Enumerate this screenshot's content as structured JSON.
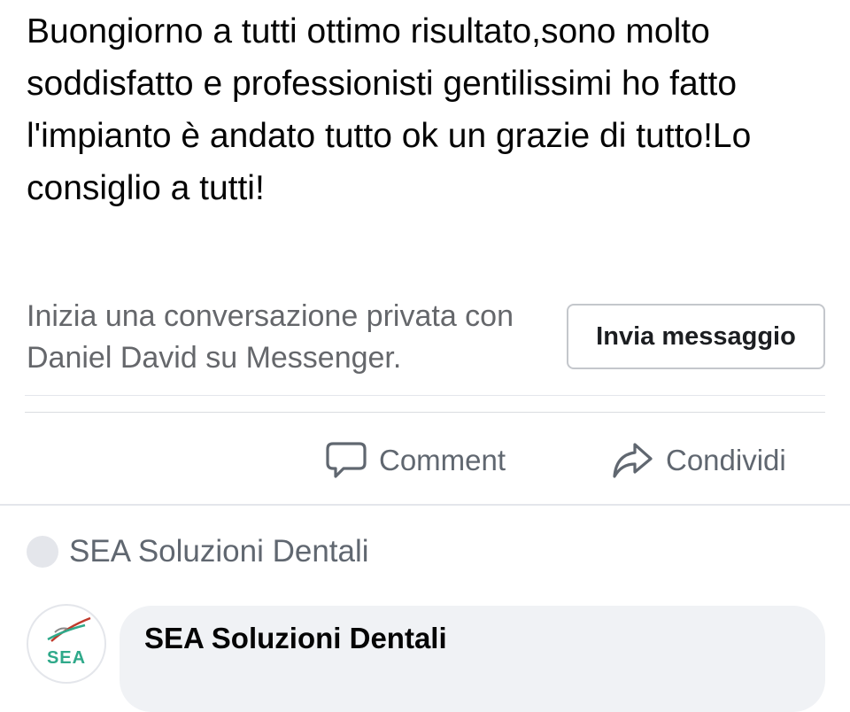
{
  "post": {
    "text": "Buongiorno a tutti ottimo risultato,sono molto soddisfatto e professionisti gentilissimi ho fatto l'impianto è andato tutto ok un grazie di tutto!Lo consiglio a tutti!"
  },
  "messenger_prompt": {
    "text": "Inizia una conversazione privata con Daniel David su Messenger.",
    "button_label": "Invia messaggio"
  },
  "actions": {
    "comment_label": "Comment",
    "comment_icon": "comment-bubble-icon",
    "share_label": "Condividi",
    "share_icon": "share-arrow-icon"
  },
  "page_reply": {
    "page_name": "SEA Soluzioni Dentali",
    "comment_author": "SEA Soluzioni Dentali",
    "logo_text": "SEA"
  },
  "colors": {
    "text_primary": "#050505",
    "text_secondary": "#65676b",
    "divider": "#e4e6eb",
    "bubble_bg": "#f0f2f5",
    "logo_accent": "#2fa98a"
  }
}
